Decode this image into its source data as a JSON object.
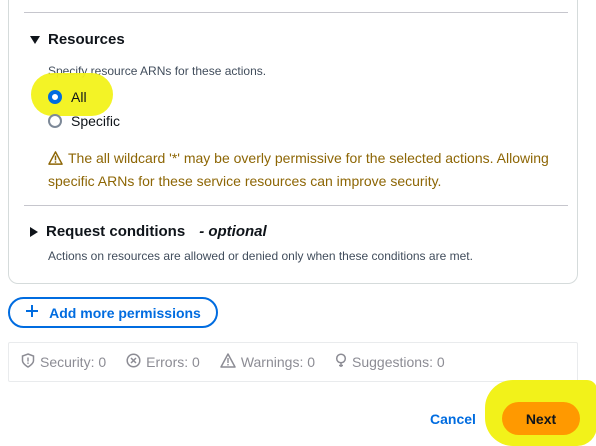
{
  "resources": {
    "title": "Resources",
    "description": "Specify resource ARNs for these actions.",
    "options": [
      {
        "label": "All",
        "selected": true
      },
      {
        "label": "Specific",
        "selected": false
      }
    ],
    "warning": "The all wildcard '*' may be overly permissive for the selected actions. Allowing specific ARNs for these service resources can improve security."
  },
  "request_conditions": {
    "title": "Request conditions",
    "optional_label": "- optional",
    "description": "Actions on resources are allowed or denied only when these conditions are met."
  },
  "add_permissions_label": "Add more permissions",
  "stats": {
    "security": "Security: 0",
    "errors": "Errors: 0",
    "warnings": "Warnings: 0",
    "suggestions": "Suggestions: 0"
  },
  "footer": {
    "cancel_label": "Cancel",
    "next_label": "Next"
  },
  "colors": {
    "primary": "#006ce0",
    "next_button": "#ff9900",
    "warning_text": "#8d6605",
    "highlight": "#f2f21a"
  },
  "icons": [
    "caret-down-icon",
    "caret-right-icon",
    "warning-icon",
    "plus-icon",
    "shield-icon",
    "error-circle-icon",
    "warning-triangle-icon",
    "lightbulb-icon"
  ]
}
